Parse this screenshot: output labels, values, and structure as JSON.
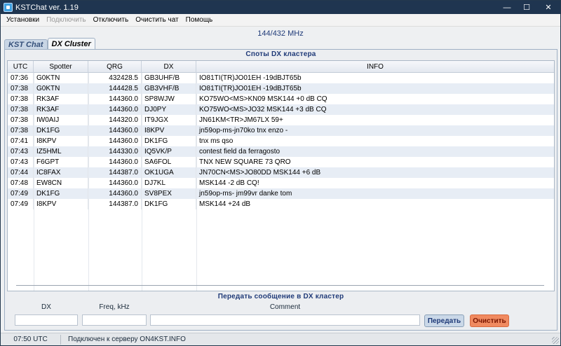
{
  "window": {
    "title": "KSTChat ver. 1.19",
    "controls": {
      "minimize": "—",
      "maximize": "☐",
      "close": "✕"
    }
  },
  "menu": {
    "items": [
      {
        "label": "Установки",
        "enabled": true
      },
      {
        "label": "Подключить",
        "enabled": false
      },
      {
        "label": "Отключить",
        "enabled": true
      },
      {
        "label": "Очистить чат",
        "enabled": true
      },
      {
        "label": "Помощь",
        "enabled": true
      }
    ]
  },
  "band": "144/432 MHz",
  "tabs": [
    {
      "label": "KST Chat",
      "active": false
    },
    {
      "label": "DX Cluster",
      "active": true
    }
  ],
  "spots": {
    "title": "Споты DX кластера",
    "columns": [
      "UTC",
      "Spotter",
      "QRG",
      "DX",
      "INFO"
    ],
    "rows": [
      {
        "utc": "07:36",
        "spotter": "G0KTN",
        "qrg": "432428.5",
        "dx": "GB3UHF/B",
        "info": "IO81TI(TR)JO01EH -19dBJT65b"
      },
      {
        "utc": "07:38",
        "spotter": "G0KTN",
        "qrg": "144428.5",
        "dx": "GB3VHF/B",
        "info": "IO81TI(TR)JO01EH -19dBJT65b"
      },
      {
        "utc": "07:38",
        "spotter": "RK3AF",
        "qrg": "144360.0",
        "dx": "SP8WJW",
        "info": "KO75WO<MS>KN09 MSK144 +0 dB CQ"
      },
      {
        "utc": "07:38",
        "spotter": "RK3AF",
        "qrg": "144360.0",
        "dx": "DJ0PY",
        "info": "KO75WO<MS>JO32 MSK144 +3 dB CQ"
      },
      {
        "utc": "07:38",
        "spotter": "IW0AIJ",
        "qrg": "144320.0",
        "dx": "IT9JGX",
        "info": "JN61KM<TR>JM67LX 59+"
      },
      {
        "utc": "07:38",
        "spotter": "DK1FG",
        "qrg": "144360.0",
        "dx": "I8KPV",
        "info": "jn59op-ms-jn70ko tnx enzo -"
      },
      {
        "utc": "07:41",
        "spotter": "I8KPV",
        "qrg": "144360.0",
        "dx": "DK1FG",
        "info": "tnx  ms qso"
      },
      {
        "utc": "07:43",
        "spotter": "IZ5HML",
        "qrg": "144330.0",
        "dx": "IQ5VK/P",
        "info": "contest  field da ferragosto"
      },
      {
        "utc": "07:43",
        "spotter": "F6GPT",
        "qrg": "144360.0",
        "dx": "SA6FOL",
        "info": "TNX NEW SQUARE 73 QRO"
      },
      {
        "utc": "07:44",
        "spotter": "IC8FAX",
        "qrg": "144387.0",
        "dx": "OK1UGA",
        "info": "JN70CN<MS>JO80DD MSK144 +6 dB"
      },
      {
        "utc": "07:48",
        "spotter": "EW8CN",
        "qrg": "144360.0",
        "dx": "DJ7KL",
        "info": "MSK144 -2 dB CQ!"
      },
      {
        "utc": "07:49",
        "spotter": "DK1FG",
        "qrg": "144360.0",
        "dx": "SV8PEX",
        "info": "jn59op-ms- jm99vr danke tom"
      },
      {
        "utc": "07:49",
        "spotter": "I8KPV",
        "qrg": "144387.0",
        "dx": "DK1FG",
        "info": "MSK144 +24 dB"
      }
    ]
  },
  "send": {
    "title": "Передать сообщение в DX кластер",
    "labels": {
      "dx": "DX",
      "freq": "Freq, kHz",
      "comment": "Comment"
    },
    "values": {
      "dx": "",
      "freq": "",
      "comment": ""
    },
    "buttons": {
      "send": "Передать",
      "clear": "Очистить"
    }
  },
  "status": {
    "time": "07:50 UTC",
    "connection": "Подключен к серверу ON4KST.INFO"
  },
  "colors": {
    "title_bar": "#1f3550",
    "accent_text": "#1f3a78",
    "clear_button": "#f08a60",
    "alt_row": "#e7edf5"
  },
  "icons": {
    "app": "app-icon"
  }
}
